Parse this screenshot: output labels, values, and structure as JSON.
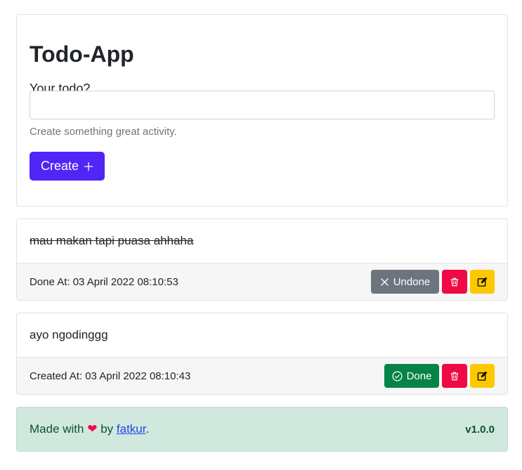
{
  "app": {
    "title": "Todo-App",
    "input_label": "Your todo?",
    "input_value": "",
    "input_placeholder": "",
    "help_text": "Create something great activity.",
    "create_label": "Create"
  },
  "todos": [
    {
      "text": "mau makan tapi puasa ahhaha",
      "done": true,
      "timestamp": "Done At: 03 April 2022 08:10:53",
      "toggle_label": "Undone"
    },
    {
      "text": "ayo ngodinggg",
      "done": false,
      "timestamp": "Created At: 03 April 2022 08:10:43",
      "toggle_label": "Done"
    }
  ],
  "footer": {
    "made_with": "Made with",
    "by": "by",
    "author": "fatkur",
    "period": ".",
    "version": "v1.0.0"
  },
  "colors": {
    "primary": "#5025f5",
    "success": "#068448",
    "secondary": "#6c757d",
    "danger": "#ee0a45",
    "warning": "#fdc800",
    "footer_bg": "#d1e8df"
  },
  "icons": {
    "create": "plus-icon",
    "undone": "x-icon",
    "done": "check-circle-icon",
    "delete": "trash-icon",
    "edit": "edit-icon",
    "heart": "heart-icon"
  }
}
